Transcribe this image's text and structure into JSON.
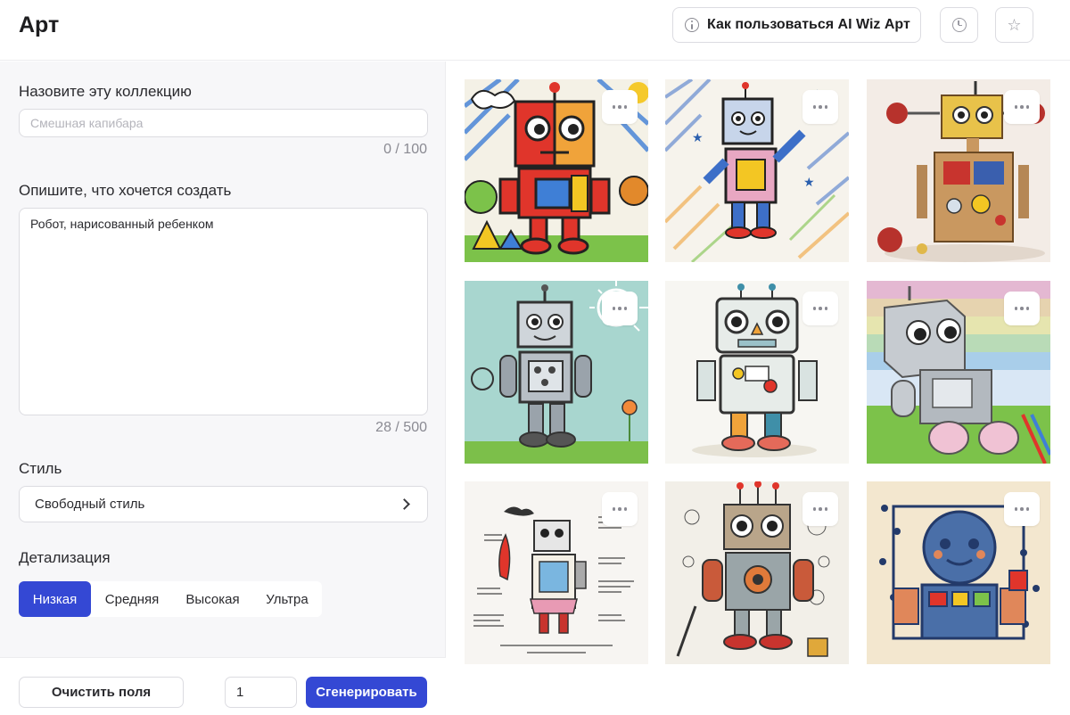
{
  "header": {
    "title": "Арт",
    "help_button_label": "Как пользоваться AI Wiz Арт"
  },
  "form": {
    "collection_name": {
      "label": "Назовите эту коллекцию",
      "placeholder": "Смешная капибара",
      "value": "",
      "counter": "0 / 100"
    },
    "prompt": {
      "label": "Опишите, что хочется создать",
      "value": "Робот, нарисованный ребенком",
      "counter": "28 / 500"
    },
    "style": {
      "label": "Стиль",
      "value": "Свободный стиль"
    },
    "detail": {
      "label": "Детализация",
      "options": [
        "Низкая",
        "Средняя",
        "Высокая",
        "Ультра"
      ],
      "selected": "Низкая"
    },
    "actions": {
      "clear_label": "Очистить поля",
      "quantity": "1",
      "generate_label": "Сгенерировать"
    }
  },
  "gallery": {
    "images": [
      {
        "subject": "robot-crayon-red-yellow"
      },
      {
        "subject": "robot-pencil-waving"
      },
      {
        "subject": "robot-cardboard-3d"
      },
      {
        "subject": "robot-teal-sun"
      },
      {
        "subject": "robot-doodle-gears"
      },
      {
        "subject": "robot-rainbow-field"
      },
      {
        "subject": "robot-annotated-sketch"
      },
      {
        "subject": "robot-sketch-gears"
      },
      {
        "subject": "robot-mosaic-blue"
      }
    ]
  },
  "colors": {
    "accent": "#3448d4",
    "panel_bg": "#f7f7f9",
    "border": "#dcdce1"
  },
  "icons": {
    "info": "info-icon",
    "history": "clock-icon",
    "favorites": "star-icon",
    "more": "dots-icon",
    "chevron": "chevron-right-icon"
  }
}
